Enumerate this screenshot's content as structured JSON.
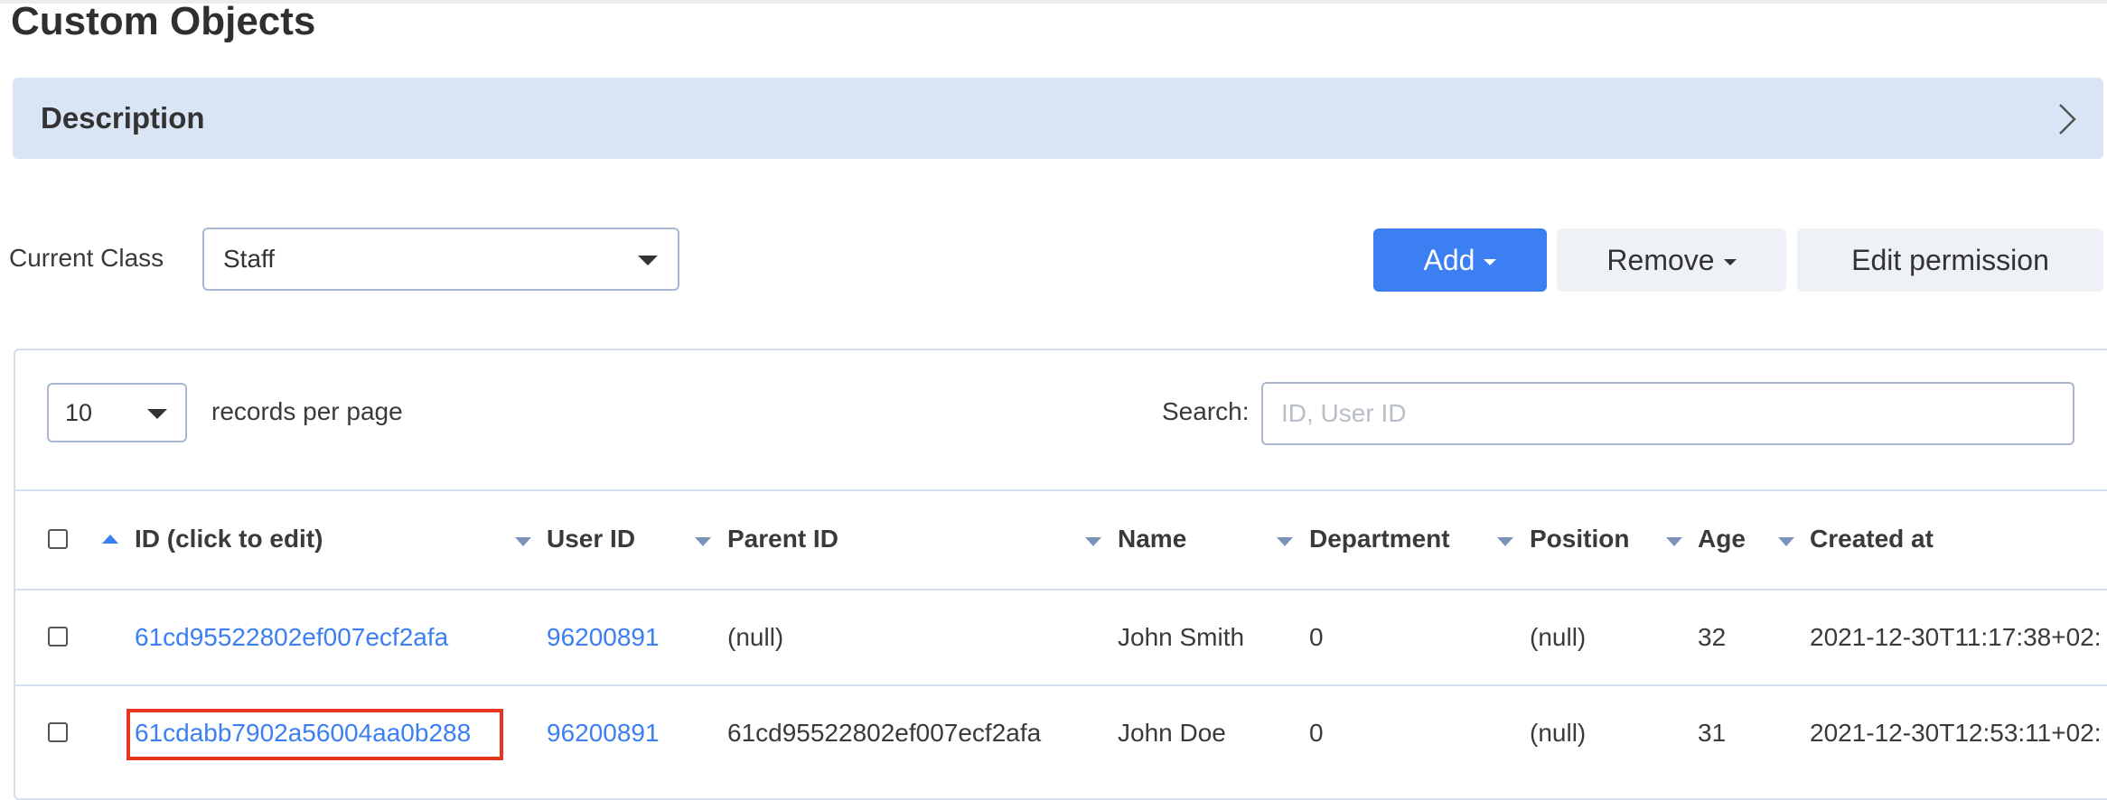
{
  "page": {
    "title": "Custom Objects"
  },
  "description_panel": {
    "title": "Description"
  },
  "class_selector": {
    "label": "Current Class",
    "value": "Staff"
  },
  "toolbar": {
    "add_label": "Add",
    "remove_label": "Remove",
    "edit_permission_label": "Edit permission"
  },
  "table_controls": {
    "per_page_value": "10",
    "per_page_label": "records per page",
    "search_label": "Search:",
    "search_placeholder": "ID, User ID",
    "search_value": ""
  },
  "table": {
    "columns": [
      "ID (click to edit)",
      "User ID",
      "Parent ID",
      "Name",
      "Department",
      "Position",
      "Age",
      "Created at"
    ],
    "rows": [
      [
        "61cd95522802ef007ecf2afa",
        "96200891",
        "(null)",
        "John Smith",
        "0",
        "(null)",
        "32",
        "2021-12-30T11:17:38+02:"
      ],
      [
        "61cdabb7902a56004aa0b288",
        "96200891",
        "61cd95522802ef007ecf2afa",
        "John Doe",
        "0",
        "(null)",
        "31",
        "2021-12-30T12:53:11+02:"
      ]
    ]
  },
  "colors": {
    "accent": "#3b7ff2",
    "highlight": "#e8341c",
    "panel": "#d9e4f5"
  },
  "icons": {
    "description_toggle": "chevron-right-icon",
    "dropdown": "caret-down-icon",
    "sort_active": "sort-asc-icon",
    "sort_inactive": "sort-desc-icon"
  }
}
